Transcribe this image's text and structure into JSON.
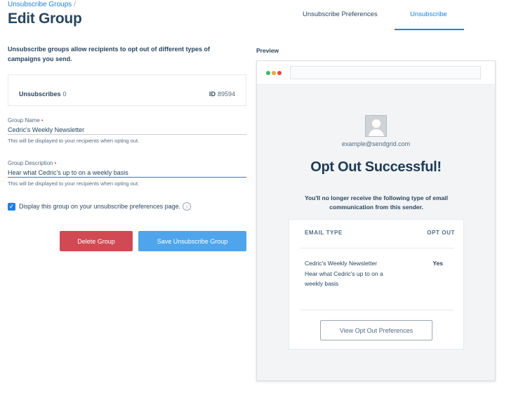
{
  "breadcrumb": {
    "link": "Unsubscribe Groups",
    "separator": "/"
  },
  "page": {
    "title": "Edit Group"
  },
  "tabs": [
    {
      "label": "Unsubscribe Preferences",
      "active": false
    },
    {
      "label": "Unsubscribe",
      "active": true
    }
  ],
  "intro": "Unsubscribe groups allow recipients to opt out of different types of campaigns you send.",
  "stats": {
    "unsubscribes_label": "Unsubscribes",
    "unsubscribes_value": "0",
    "id_label": "ID",
    "id_value": "89594"
  },
  "form": {
    "name_label": "Group Name",
    "name_value": "Cedric's Weekly Newsletter",
    "name_help": "This will be displayed to your recipients when opting out.",
    "desc_label": "Group Description",
    "desc_value": "Hear what Cedric's up to on a weekly basis",
    "desc_help": "This will be displayed to your recipients when opting out.",
    "required_marker": "•",
    "checkbox_label": "Display this group on your unsubscribe preferences page.",
    "checkbox_checked": true
  },
  "buttons": {
    "delete": "Delete Group",
    "save": "Save Unsubscribe Group"
  },
  "preview": {
    "label": "Preview",
    "email": "example@sendgrid.com",
    "title": "Opt Out Successful!",
    "subtitle": "You'll no longer receive the following type of email communication from this sender.",
    "table": {
      "col_type": "EMAIL TYPE",
      "col_opt": "OPT OUT",
      "row_name": "Cedric's Weekly Newsletter",
      "row_desc": "Hear what Cedric's up to on a weekly basis",
      "row_opt": "Yes"
    },
    "button": "View Opt Out Preferences"
  },
  "colors": {
    "accent": "#1a82e2",
    "danger": "#d14a53",
    "primary_button": "#4ea5ec",
    "text": "#294661"
  },
  "icons": {
    "checkbox": "check-icon",
    "info": "info-icon",
    "avatar": "user-avatar-icon"
  }
}
